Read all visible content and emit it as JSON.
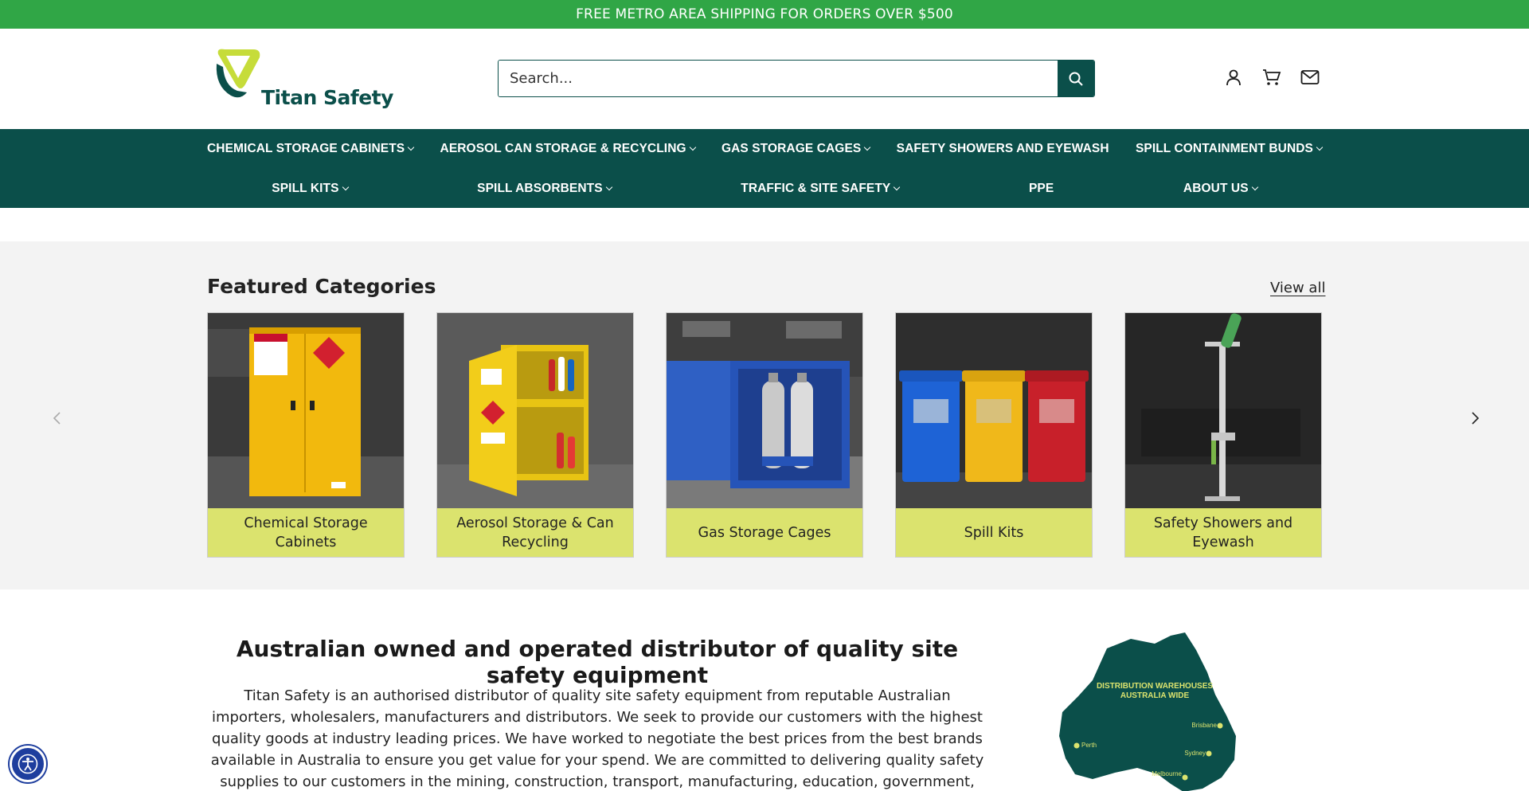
{
  "announcement": "FREE METRO AREA SHIPPING FOR ORDERS OVER $500",
  "brand": {
    "name": "Titan Safety",
    "primary": "#0b4f4a",
    "accent": "#30a646",
    "lime": "#dbe36e"
  },
  "search": {
    "placeholder": "Search..."
  },
  "header_icons": [
    "account-icon",
    "cart-icon",
    "mail-icon"
  ],
  "nav": {
    "row1": [
      {
        "label": "CHEMICAL STORAGE CABINETS",
        "dropdown": true
      },
      {
        "label": "AEROSOL CAN STORAGE & RECYCLING",
        "dropdown": true
      },
      {
        "label": "GAS STORAGE CAGES",
        "dropdown": true
      },
      {
        "label": "SAFETY SHOWERS AND EYEWASH",
        "dropdown": false
      },
      {
        "label": "SPILL CONTAINMENT BUNDS",
        "dropdown": true
      }
    ],
    "row2": [
      {
        "label": "SPILL KITS",
        "dropdown": true
      },
      {
        "label": "SPILL ABSORBENTS",
        "dropdown": true
      },
      {
        "label": "TRAFFIC & SITE SAFETY",
        "dropdown": true
      },
      {
        "label": "PPE",
        "dropdown": false
      },
      {
        "label": "ABOUT US",
        "dropdown": true
      }
    ]
  },
  "featured": {
    "title": "Featured Categories",
    "view_all": "View all",
    "cards": [
      {
        "label": "Chemical Storage Cabinets"
      },
      {
        "label": "Aerosol Storage & Can Recycling"
      },
      {
        "label": "Gas Storage Cages"
      },
      {
        "label": "Spill Kits"
      },
      {
        "label": "Safety Showers and Eyewash"
      }
    ]
  },
  "about": {
    "title": "Australian owned and operated distributor of quality site safety equipment",
    "text": "Titan Safety is an authorised distributor of quality site safety equipment from reputable Australian importers, wholesalers, manufacturers and distributors. We seek to provide our customers with the highest quality goods at industry leading prices. We have worked to negotiate the best prices from the best brands available in Australia to ensure you get value for your spend. We are committed to delivering quality safety supplies to our customers in the mining, construction, transport, manufacturing, education, government, logistics and warehousing industries.",
    "map": {
      "heading_line1": "DISTRIBUTION WAREHOUSES",
      "heading_line2": "AUSTRALIA WIDE",
      "cities": [
        "Brisbane",
        "Perth",
        "Sydney",
        "Melbourne"
      ]
    }
  }
}
